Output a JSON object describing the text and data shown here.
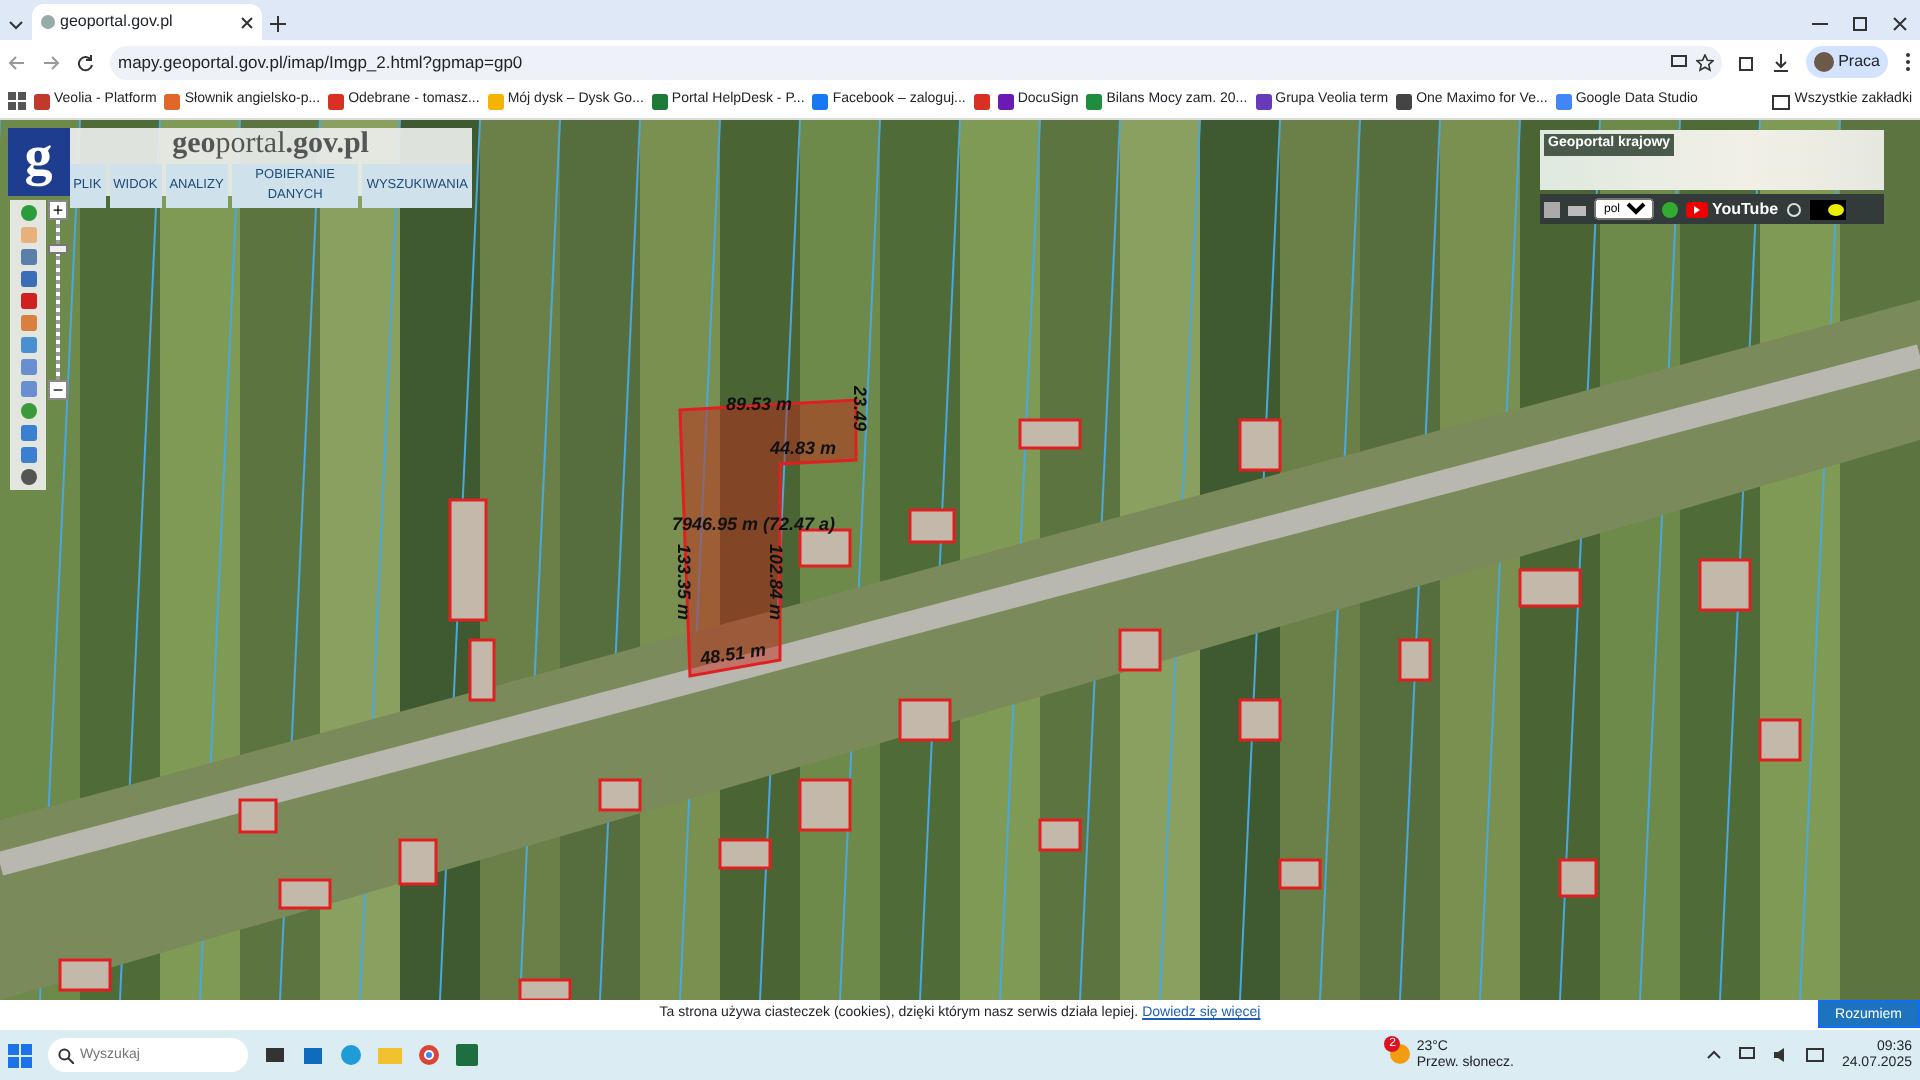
{
  "browser": {
    "tab_title": "geoportal.gov.pl",
    "url": "mapy.geoportal.gov.pl/imap/Imgp_2.html?gpmap=gp0",
    "profile": "Praca",
    "bookmarks": [
      {
        "label": "Veolia - Platform",
        "color": "#c0392b"
      },
      {
        "label": "Słownik angielsko-p...",
        "color": "#e0662a"
      },
      {
        "label": "Odebrane - tomasz...",
        "color": "#d93025"
      },
      {
        "label": "Mój dysk – Dysk Go...",
        "color": "#f4b400"
      },
      {
        "label": "Portal HelpDesk - P...",
        "color": "#1f7a3a"
      },
      {
        "label": "Facebook – zaloguj...",
        "color": "#1877f2"
      },
      {
        "kind": "icon",
        "color": "#d93025"
      },
      {
        "label": "DocuSign",
        "color": "#6a1bb3"
      },
      {
        "label": "Bilans Mocy zam. 20...",
        "color": "#1e8e3e"
      },
      {
        "label": "Grupa Veolia term",
        "color": "#673ab7"
      },
      {
        "label": "One Maximo for Ve...",
        "color": "#444444"
      },
      {
        "label": "Google Data Studio",
        "color": "#4285f4"
      }
    ],
    "all_bookmarks": "Wszystkie zakładki"
  },
  "geoportal": {
    "logo_letter": "g",
    "title": "**geo**portal**.gov.pl**",
    "menu": [
      "PLIK",
      "WIDOK",
      "ANALIZY",
      "POBIERANIE DANYCH",
      "WYSZUKIWANIA"
    ],
    "zoom": {
      "in_label": "+",
      "out_label": "−",
      "level": 0.85
    }
  },
  "overview": {
    "title": "Geoportal krajowy",
    "language": "pol",
    "video_label": "YouTube"
  },
  "map_labels": [
    {
      "text": "89.53 m",
      "kind": "horizontal"
    },
    {
      "text": "23.49",
      "kind": "vertical"
    },
    {
      "text": "44.83 m",
      "kind": "horizontal"
    },
    {
      "text": "7946.95 m (72.47 a)",
      "kind": "horizontal"
    },
    {
      "text": "133.35 m",
      "kind": "vertical"
    },
    {
      "text": "102.84 m",
      "kind": "vertical"
    },
    {
      "text": "48.51 m",
      "kind": "tilted"
    }
  ],
  "cookie_bar": {
    "text": "Ta strona używa ciasteczek (cookies), dzięki którym nasz serwis działa lepiej.",
    "link": "Dowiedz się więcej",
    "button": "Rozumiem"
  },
  "taskbar": {
    "search_placeholder": "Wyszukaj",
    "weather_badge": "2",
    "temperature": "23°C",
    "weather": "Przew. słonecz.",
    "time": "09:36",
    "date": "24.07.2025"
  }
}
